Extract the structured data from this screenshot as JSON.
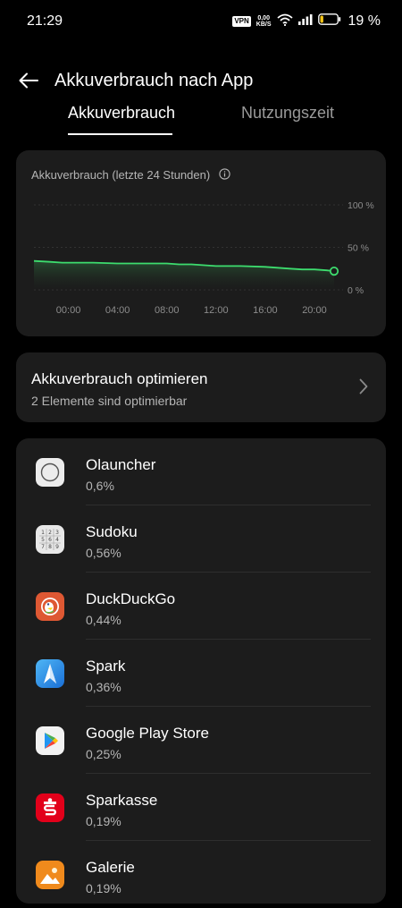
{
  "status_bar": {
    "time": "21:29",
    "vpn_label": "VPN",
    "net_speed_value": "0,00",
    "net_speed_unit": "KB/S",
    "battery_percent": "19 %",
    "battery_level": 0.19,
    "battery_color": "#f5c518"
  },
  "header": {
    "title": "Akkuverbrauch nach App",
    "back_icon": "arrow-left-icon"
  },
  "tabs": [
    {
      "label": "Akkuverbrauch",
      "active": true
    },
    {
      "label": "Nutzungszeit",
      "active": false
    }
  ],
  "chart": {
    "title": "Akkuverbrauch (letzte 24 Stunden)",
    "info_icon": "info-icon",
    "line_color": "#3ddc6e"
  },
  "chart_data": {
    "type": "area",
    "title": "Akkuverbrauch (letzte 24 Stunden)",
    "xlabel": "",
    "ylabel": "",
    "x_tick_labels": [
      "00:00",
      "04:00",
      "08:00",
      "12:00",
      "16:00",
      "20:00"
    ],
    "y_tick_labels": [
      "100 %",
      "50 %",
      "0 %"
    ],
    "y_ticks": [
      100,
      50,
      0
    ],
    "ylim": [
      0,
      100
    ],
    "xlim": [
      -2.8,
      21.6
    ],
    "grid": true,
    "series": [
      {
        "x": [
          -2.8,
          -1.5,
          -0.5,
          0.5,
          2,
          4,
          6,
          8,
          9,
          10,
          12,
          14,
          16,
          17,
          18,
          19,
          20,
          21,
          21.6
        ],
        "values": [
          34,
          33,
          32,
          32,
          32,
          31,
          31,
          31,
          30,
          30,
          28,
          28,
          27,
          26,
          25,
          24,
          24,
          23,
          22
        ]
      }
    ]
  },
  "optimize": {
    "title": "Akkuverbrauch optimieren",
    "subtitle": "2 Elemente sind optimierbar",
    "chevron_icon": "chevron-right-icon"
  },
  "apps": [
    {
      "name": "Olauncher",
      "percent": "0,6%",
      "icon": "olauncher-icon"
    },
    {
      "name": "Sudoku",
      "percent": "0,56%",
      "icon": "sudoku-icon",
      "icon_digits": [
        "1",
        "2",
        "3",
        "5",
        "6",
        "4",
        "7",
        "8",
        "9"
      ]
    },
    {
      "name": "DuckDuckGo",
      "percent": "0,44%",
      "icon": "duckduckgo-icon"
    },
    {
      "name": "Spark",
      "percent": "0,36%",
      "icon": "spark-icon"
    },
    {
      "name": "Google Play Store",
      "percent": "0,25%",
      "icon": "google-play-store-icon"
    },
    {
      "name": "Sparkasse",
      "percent": "0,19%",
      "icon": "sparkasse-icon"
    },
    {
      "name": "Galerie",
      "percent": "0,19%",
      "icon": "galerie-icon"
    }
  ]
}
